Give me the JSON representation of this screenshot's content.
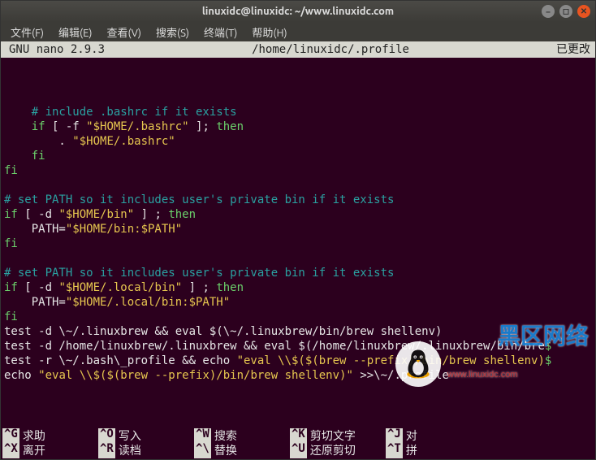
{
  "title": "linuxidc@linuxidc: ~/www.linuxidc.com",
  "menu": [
    {
      "label": "文件(F)"
    },
    {
      "label": "编辑(E)"
    },
    {
      "label": "查看(V)"
    },
    {
      "label": "搜索(S)"
    },
    {
      "label": "终端(T)"
    },
    {
      "label": "帮助(H)"
    }
  ],
  "nano_header": {
    "left": "  GNU nano 2.9.3",
    "center": "/home/linuxidc/.profile",
    "right": "已更改 "
  },
  "code": [
    [],
    [
      {
        "c": "comment",
        "t": "    # include .bashrc if it exists"
      }
    ],
    [
      {
        "t": "    "
      },
      {
        "c": "key",
        "t": "if"
      },
      {
        "t": " [ -f "
      },
      {
        "c": "str",
        "t": "\"$HOME/.bashrc\""
      },
      {
        "t": " ]; "
      },
      {
        "c": "key",
        "t": "then"
      }
    ],
    [
      {
        "t": "        . "
      },
      {
        "c": "str",
        "t": "\"$HOME/.bashrc\""
      }
    ],
    [
      {
        "t": "    "
      },
      {
        "c": "key",
        "t": "fi"
      }
    ],
    [
      {
        "c": "key",
        "t": "fi"
      }
    ],
    [],
    [
      {
        "c": "comment",
        "t": "# set PATH so it includes user's private bin if it exists"
      }
    ],
    [
      {
        "c": "key",
        "t": "if"
      },
      {
        "t": " [ -d "
      },
      {
        "c": "str",
        "t": "\"$HOME/bin\""
      },
      {
        "t": " ] ; "
      },
      {
        "c": "key",
        "t": "then"
      }
    ],
    [
      {
        "t": "    PATH="
      },
      {
        "c": "str",
        "t": "\"$HOME/bin:$PATH\""
      }
    ],
    [
      {
        "c": "key",
        "t": "fi"
      }
    ],
    [],
    [
      {
        "c": "comment",
        "t": "# set PATH so it includes user's private bin if it exists"
      }
    ],
    [
      {
        "c": "key",
        "t": "if"
      },
      {
        "t": " [ -d "
      },
      {
        "c": "str",
        "t": "\"$HOME/.local/bin\""
      },
      {
        "t": " ] ; "
      },
      {
        "c": "key",
        "t": "then"
      }
    ],
    [
      {
        "t": "    PATH="
      },
      {
        "c": "str",
        "t": "\"$HOME/.local/bin:$PATH\""
      }
    ],
    [
      {
        "c": "key",
        "t": "fi"
      }
    ],
    [
      {
        "t": "test -d \\~/.linuxbrew && eval $(\\~/.linuxbrew/bin/brew shellenv)"
      }
    ],
    [
      {
        "t": "test -d /home/linuxbrew/.linuxbrew && eval $(/home/linuxbrew/.linuxbrew/bin/bre"
      },
      {
        "c": "key",
        "t": "$"
      }
    ],
    [
      {
        "t": "test -r \\~/.bash\\_profile && echo "
      },
      {
        "c": "str",
        "t": "\"eval \\\\$($(brew --prefix)/bin/brew shellenv)"
      },
      {
        "c": "key",
        "t": "$"
      }
    ],
    [
      {
        "t": "echo "
      },
      {
        "c": "str",
        "t": "\"eval \\\\$($(brew --prefix)/bin/brew shellenv)\""
      },
      {
        "t": " >>\\~/.profile"
      }
    ]
  ],
  "watermark": {
    "line1": "黑区网络",
    "line2": "www.linuxidc.com"
  },
  "help": {
    "row1": [
      {
        "key": "^G",
        "label": "求助"
      },
      {
        "key": "^O",
        "label": "写入"
      },
      {
        "key": "^W",
        "label": "搜索"
      },
      {
        "key": "^K",
        "label": "剪切文字"
      },
      {
        "key": "^J",
        "label": "对"
      }
    ],
    "row2": [
      {
        "key": "^X",
        "label": "离开"
      },
      {
        "key": "^R",
        "label": "读档"
      },
      {
        "key": "^\\",
        "label": "替换"
      },
      {
        "key": "^U",
        "label": "还原剪切"
      },
      {
        "key": "^T",
        "label": "拼"
      }
    ]
  }
}
